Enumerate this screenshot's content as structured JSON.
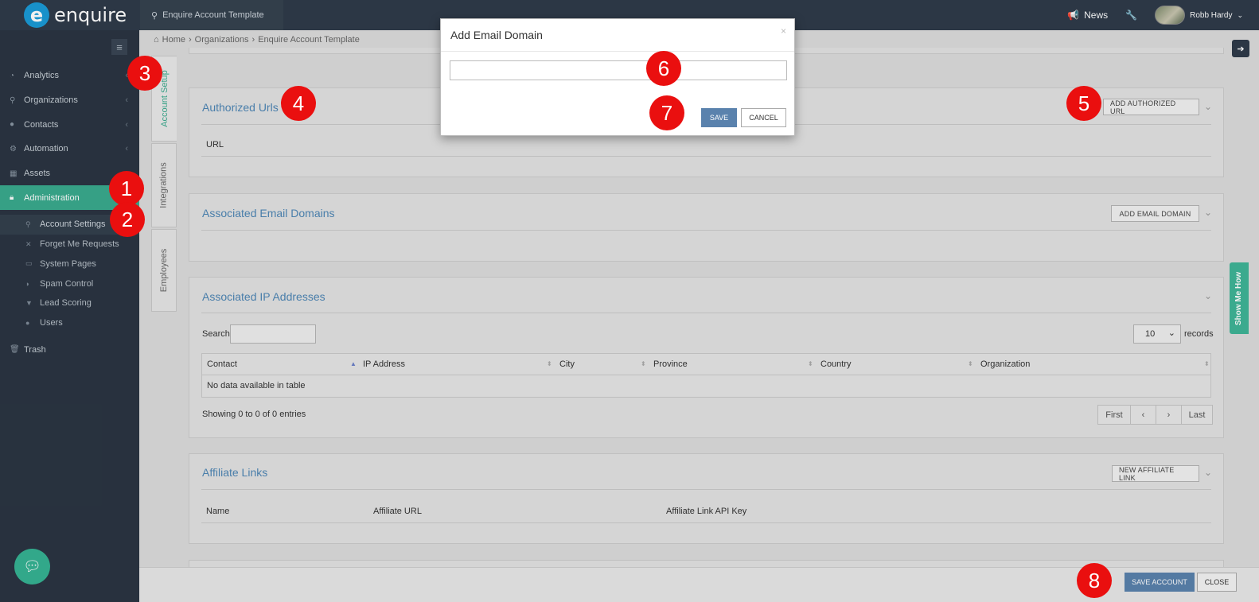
{
  "topbar": {
    "logo_text": "enquire",
    "logo_mark": "e",
    "tab_label": "Enquire Account Template",
    "news_label": "News",
    "user_name": "Robb Hardy"
  },
  "sidebar": {
    "items": [
      {
        "label": "Analytics",
        "icon": "dashboard-icon"
      },
      {
        "label": "Organizations",
        "icon": "sitemap-icon"
      },
      {
        "label": "Contacts",
        "icon": "users-icon"
      },
      {
        "label": "Automation",
        "icon": "cogs-icon"
      },
      {
        "label": "Assets",
        "icon": "grid-icon"
      },
      {
        "label": "Administration",
        "icon": "lock-icon"
      }
    ],
    "subitems": [
      {
        "label": "Account Settings"
      },
      {
        "label": "Forget Me Requests"
      },
      {
        "label": "System Pages"
      },
      {
        "label": "Spam Control"
      },
      {
        "label": "Lead Scoring"
      },
      {
        "label": "Users"
      }
    ],
    "trash_label": "Trash"
  },
  "breadcrumb": {
    "home": "Home",
    "organizations": "Organizations",
    "current": "Enquire Account Template"
  },
  "vtabs": [
    "Account Setup",
    "Integrations",
    "Employees"
  ],
  "authorized_urls": {
    "title": "Authorized Urls",
    "button": "ADD AUTHORIZED URL",
    "column": "URL"
  },
  "email_domains": {
    "title": "Associated Email Domains",
    "button": "ADD EMAIL DOMAIN"
  },
  "ip_addresses": {
    "title": "Associated IP Addresses",
    "search_label": "Search:",
    "page_size": "10",
    "records_label": "records",
    "columns": [
      "Contact",
      "IP Address",
      "City",
      "Province",
      "Country",
      "Organization"
    ],
    "empty_text": "No data available in table",
    "info_text": "Showing 0 to 0 of 0 entries",
    "pager": [
      "First",
      "‹",
      "›",
      "Last"
    ]
  },
  "affiliate_links": {
    "title": "Affiliate Links",
    "button": "NEW AFFILIATE LINK",
    "columns": [
      "Name",
      "Affiliate URL",
      "Affiliate Link API Key"
    ]
  },
  "footer": {
    "save_label": "SAVE ACCOUNT",
    "close_label": "CLOSE"
  },
  "show_me_how": "Show Me How",
  "modal": {
    "title": "Add Email Domain",
    "close_glyph": "×",
    "input_value": "",
    "save_label": "SAVE",
    "cancel_label": "CANCEL"
  },
  "callouts": [
    "1",
    "2",
    "3",
    "4",
    "5",
    "6",
    "7",
    "8"
  ],
  "colors": {
    "topbar": "#2f3b4a",
    "sidebar": "#2b3542",
    "active_nav": "#3aaa8e",
    "link_title": "#4e86b5",
    "primary_button": "#5a82ad",
    "callout": "#ea0f0f",
    "show_me_how": "#3fb597"
  }
}
